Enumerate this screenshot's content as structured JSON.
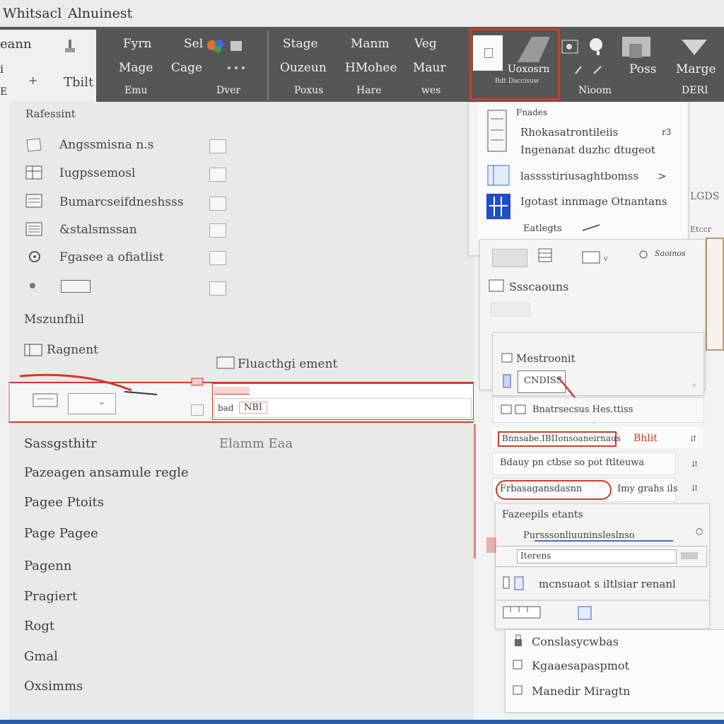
{
  "window": {
    "title_left": "Whitsacl",
    "title_right": "Alnuinest"
  },
  "ribbon": {
    "left_labels": [
      "eann",
      "i",
      "E"
    ],
    "active_tab": {
      "icon": "paint-brush-icon",
      "label_top": "+",
      "label": "Tbilt"
    },
    "col1": {
      "top": "Fyrn",
      "mid": "Mage",
      "bottom": "Emu"
    },
    "col2": {
      "top": "Sel",
      "mid": "Cage",
      "bottom": "Dver"
    },
    "col3": {
      "top": "Stage",
      "mid": "Ouzeun",
      "bottom": "Poxus"
    },
    "col4": {
      "top": "Manm",
      "mid": "HMohee",
      "bottom": "Hare"
    },
    "col5": {
      "top": "Veg",
      "mid": "Maur",
      "bottom": "wes"
    },
    "highlight_group": {
      "label": "Uoxosrn",
      "sub": "Bdt Daccisuw"
    },
    "col6": {
      "bottom": "Nioom"
    },
    "col7": {
      "mid": "Poss"
    },
    "col8": {
      "mid": "Marge",
      "bottom": "DERI"
    }
  },
  "left_panel": {
    "section1_header": "Rafessint",
    "options": [
      {
        "label": "Angssmisna n.s",
        "icon": "page-icon"
      },
      {
        "label": "Iugpssemosl",
        "icon": "table-icon"
      },
      {
        "label": "Bumarcseifdneshsss",
        "icon": "document-icon"
      },
      {
        "label": "&stalsmssan",
        "icon": "list-icon"
      },
      {
        "label": "Fgasee a ofiatlist",
        "icon": "gear-icon"
      },
      {
        "label": "",
        "icon": "box-icon"
      }
    ],
    "section2_header": "Mszunfhil",
    "section2_item": "Ragnent",
    "arrangement_label": "Fluacthgi ement",
    "input_value": "NBI",
    "input_prefix": "bad",
    "list_header": "Sassgsthitr",
    "list_header_right": "Elamm Eaa",
    "list": [
      "Pazeagen ansamule regle",
      "Pagee Ptoits",
      "Page Pagee",
      "Pagenn",
      "Pragiert",
      "Rogt",
      "Gmal",
      "Oxsimms"
    ]
  },
  "flyout1": {
    "header": "Fnades",
    "lines": [
      "Rhokasatrontileiis",
      "Ingenanat duzhc dtugeot",
      "lasssstiriusaghtbomss",
      "Igotast innmage Otnantans",
      "Eatlegts"
    ],
    "side_label": "LGDS",
    "side_label2": "Etccr"
  },
  "flyout2": {
    "tools_label": "Saoinos",
    "header": "Ssscaouns",
    "group_label": "Mestroonit",
    "field_value": "CNDISS",
    "row1": "Bnatrsecsus Hes.ttiss",
    "row2": "Bnnsabe.IBIIonsoaneirnaus",
    "row2_right": "Bhlit",
    "row3": "Bdauy pn ctbse so pot ftlteuwa",
    "row4": "Frbasagansdasnn",
    "row4_right": "Imy grahs ils",
    "row5": "Fazeepils etants",
    "row6": "Pursssonliuuninsleslnso",
    "search_value": "Iterens",
    "row7": "mcnsuaot s iltlsiar renanl",
    "bottom_items": [
      "Conslasycwbas",
      "Kgaaesapaspmot",
      "Manedir Miragtn"
    ]
  },
  "colors": {
    "accent": "#d03a2a",
    "ribbon": "#565656",
    "taskbar": "#2c5fa8"
  }
}
